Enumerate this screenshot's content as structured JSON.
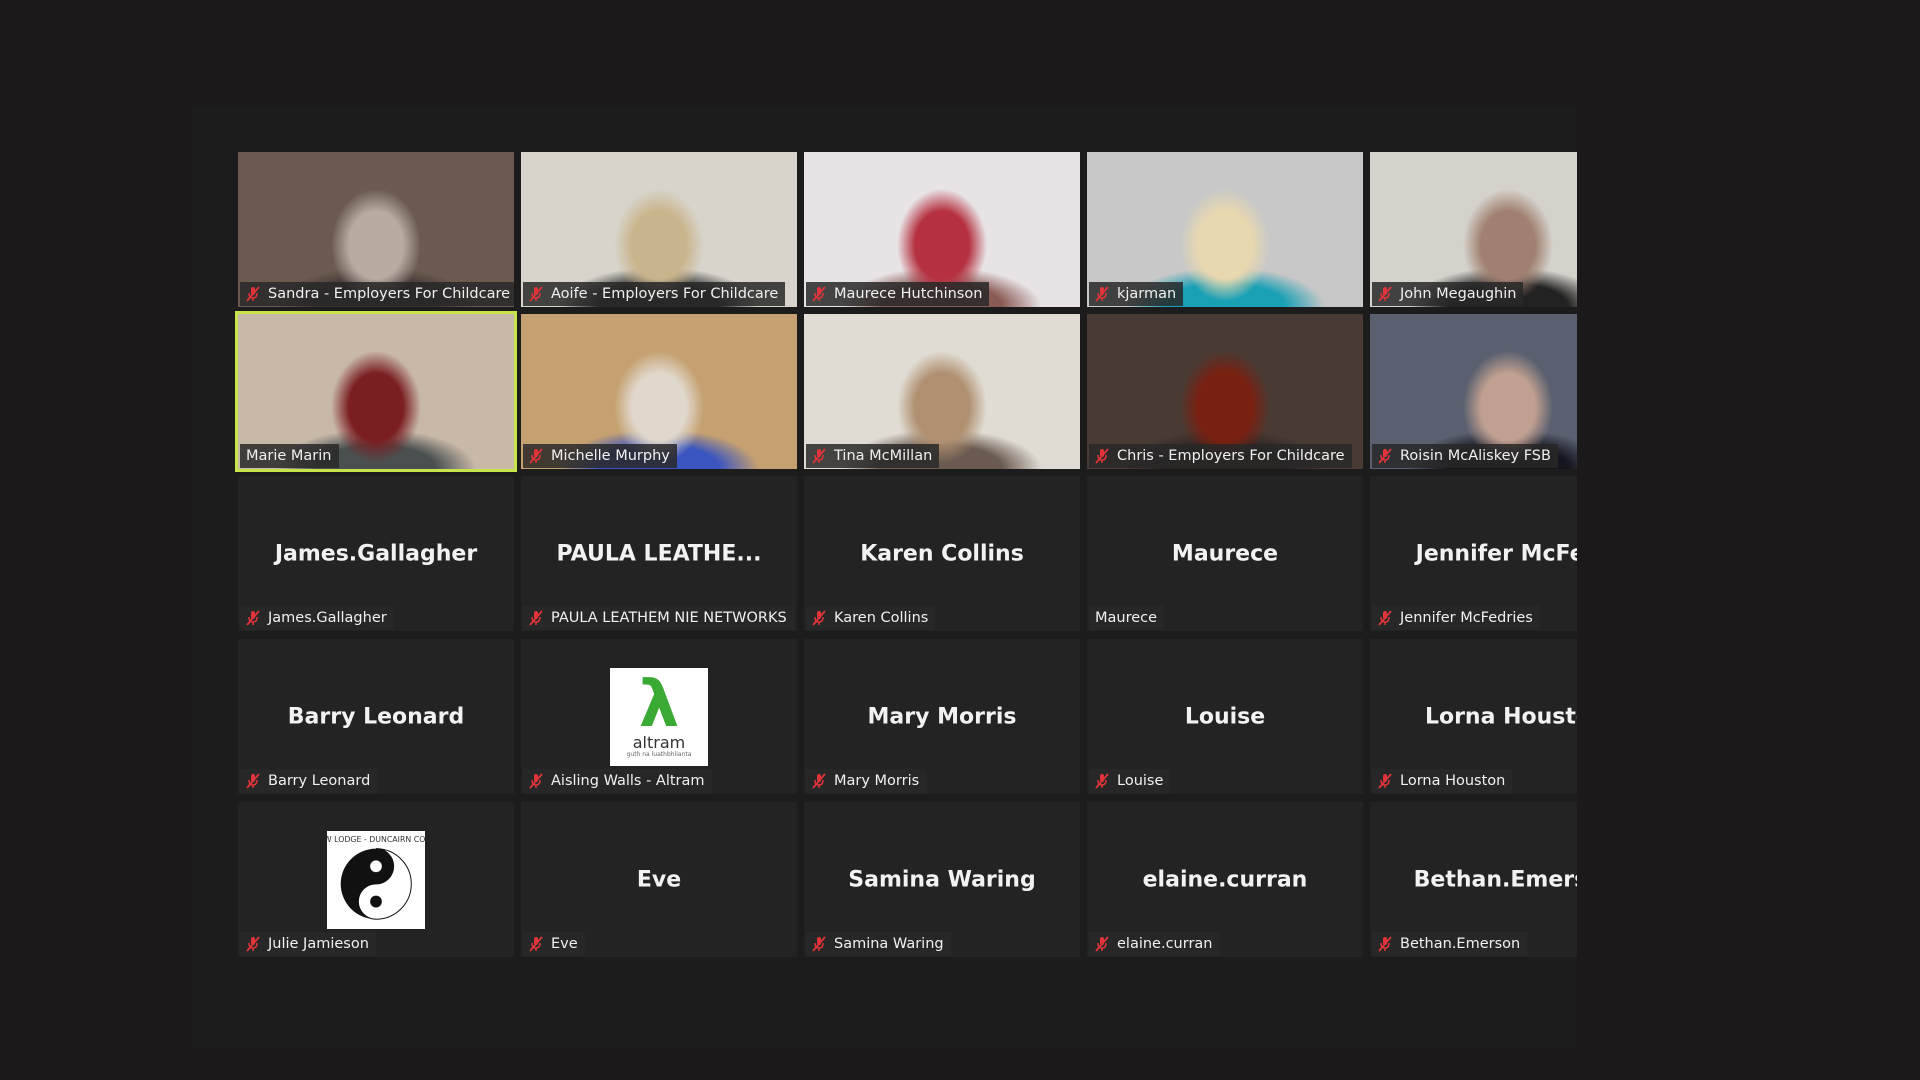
{
  "meeting": {
    "tiles": [
      {
        "label": "Sandra - Employers For Childcare",
        "muted": true,
        "kind": "video",
        "colors": [
          "#6b5a50",
          "#b8aba2",
          "#3a3030"
        ]
      },
      {
        "label": "Aoife - Employers For Childcare",
        "muted": true,
        "kind": "video",
        "colors": [
          "#d8d4cc",
          "#c9b58c",
          "#2c2c2c"
        ]
      },
      {
        "label": "Maurece Hutchinson",
        "muted": true,
        "kind": "video",
        "colors": [
          "#e8e4e6",
          "#b53040",
          "#8a5a55"
        ]
      },
      {
        "label": "kjarman",
        "muted": true,
        "kind": "video",
        "colors": [
          "#c8c8c8",
          "#e8d8b0",
          "#1aa0b5"
        ]
      },
      {
        "label": "John Megaughin",
        "muted": true,
        "kind": "video",
        "colors": [
          "#d5d2cc",
          "#a08070",
          "#222222"
        ]
      },
      {
        "label": "Marie Marin",
        "muted": false,
        "kind": "video",
        "speaking": true,
        "colors": [
          "#c8b8a8",
          "#7a1e22",
          "#4a5050"
        ]
      },
      {
        "label": "Michelle Murphy",
        "muted": true,
        "kind": "video",
        "colors": [
          "#c5a070",
          "#e0d8cc",
          "#3a55c0"
        ]
      },
      {
        "label": "Tina McMillan",
        "muted": true,
        "kind": "video",
        "colors": [
          "#e0dcd4",
          "#b09070",
          "#6a5a50"
        ]
      },
      {
        "label": "Chris - Employers For Childcare",
        "muted": true,
        "kind": "video",
        "colors": [
          "#4a3a34",
          "#7a2010",
          "#2a2220"
        ]
      },
      {
        "label": "Roisin McAliskey FSB",
        "muted": true,
        "kind": "video",
        "colors": [
          "#5a6070",
          "#c0a090",
          "#15151f"
        ]
      },
      {
        "label": "James.Gallagher",
        "muted": true,
        "kind": "name",
        "display": "James.Gallagher"
      },
      {
        "label": "PAULA LEATHEM NIE NETWORKS",
        "muted": true,
        "kind": "name",
        "display": "PAULA  LEATHE..."
      },
      {
        "label": "Karen Collins",
        "muted": true,
        "kind": "name",
        "display": "Karen Collins"
      },
      {
        "label": "Maurece",
        "muted": false,
        "kind": "name",
        "display": "Maurece"
      },
      {
        "label": "Jennifer McFedries",
        "muted": true,
        "kind": "name",
        "display": "Jennifer  McFed"
      },
      {
        "label": "Barry Leonard",
        "muted": true,
        "kind": "name",
        "display": "Barry Leonard"
      },
      {
        "label": "Aisling Walls - Altram",
        "muted": true,
        "kind": "logo-altram",
        "logo_text": "altram",
        "logo_sub": "guth na luathbhlianta"
      },
      {
        "label": "Mary Morris",
        "muted": true,
        "kind": "name",
        "display": "Mary Morris"
      },
      {
        "label": "Louise",
        "muted": true,
        "kind": "name",
        "display": "Louise"
      },
      {
        "label": "Lorna Houston",
        "muted": true,
        "kind": "name",
        "display": "Lorna Housto"
      },
      {
        "label": "Julie Jamieson",
        "muted": true,
        "kind": "logo-yinyang",
        "logo_text": "NEW LODGE - DUNCAIRN COMM"
      },
      {
        "label": "Eve",
        "muted": true,
        "kind": "name",
        "display": "Eve"
      },
      {
        "label": "Samina Waring",
        "muted": true,
        "kind": "name",
        "display": "Samina Waring"
      },
      {
        "label": "elaine.curran",
        "muted": true,
        "kind": "name",
        "display": "elaine.curran"
      },
      {
        "label": "Bethan.Emerson",
        "muted": true,
        "kind": "name",
        "display": "Bethan.Emerso"
      }
    ],
    "colors": {
      "speaker_highlight": "#c7e44a",
      "muted_icon": "#e0343a",
      "tile_bg": "#232323"
    }
  }
}
